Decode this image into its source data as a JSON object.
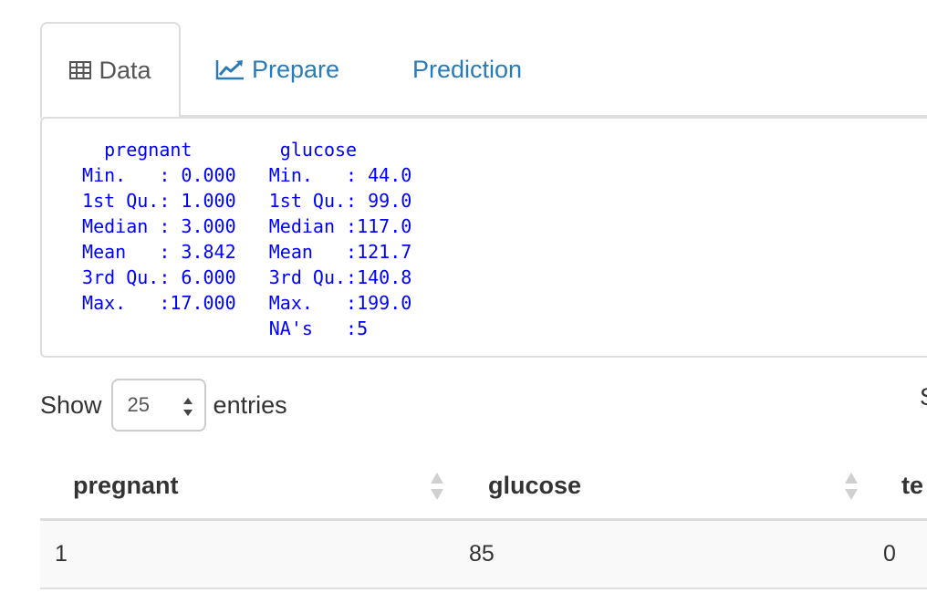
{
  "tabs": [
    {
      "label": "Data",
      "icon": "table-icon",
      "active": true
    },
    {
      "label": "Prepare",
      "icon": "line-chart-icon",
      "active": false
    },
    {
      "label": "Prediction",
      "icon": "",
      "active": false
    }
  ],
  "summary": {
    "text": "   pregnant        glucose    \n Min.   : 0.000   Min.   : 44.0  \n 1st Qu.: 1.000   1st Qu.: 99.0  \n Median : 3.000   Median :117.0  \n Mean   : 3.842   Mean   :121.7  \n 3rd Qu.: 6.000   3rd Qu.:140.8  \n Max.   :17.000   Max.   :199.0  \n                  NA's   :5      "
  },
  "length_menu": {
    "prefix": "Show",
    "value": "25",
    "suffix": "entries"
  },
  "search_label_partial": "S",
  "table": {
    "columns": [
      "pregnant",
      "glucose",
      "te"
    ],
    "rows": [
      [
        "1",
        "85",
        "0"
      ]
    ]
  },
  "colors": {
    "link": "#2a7ab8",
    "mono_text": "#0000ff",
    "border": "#dddddd"
  }
}
